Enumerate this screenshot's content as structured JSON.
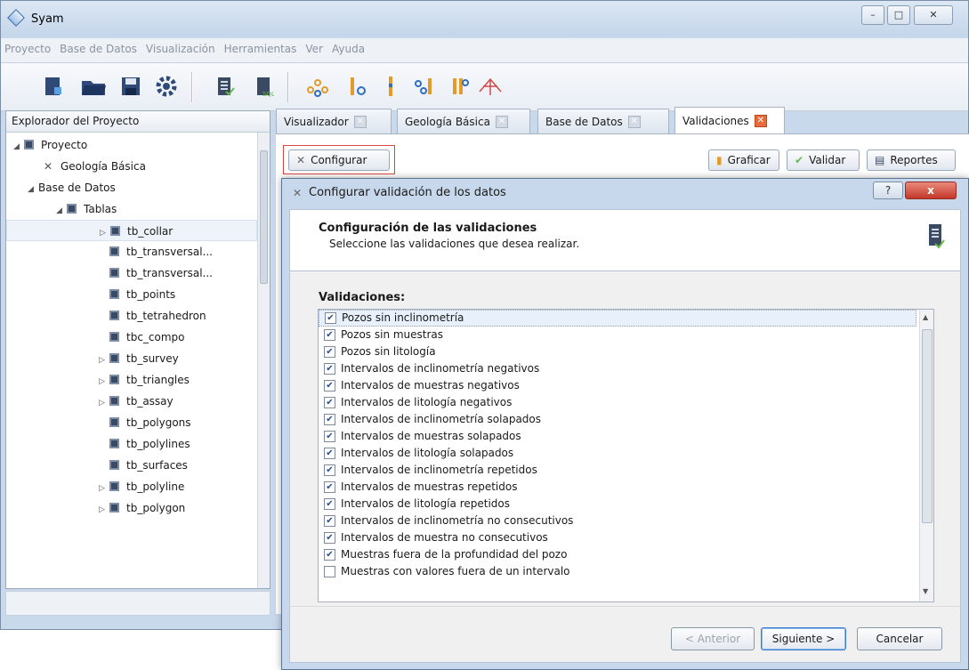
{
  "app": {
    "title": "Syam"
  },
  "window_controls": {
    "minimize": "–",
    "maximize": "□",
    "close": "✕"
  },
  "menu": [
    "Proyecto",
    "Base de Datos",
    "Visualización",
    "Herramientas",
    "Ver",
    "Ayuda"
  ],
  "explorer": {
    "title": "Explorador del Proyecto",
    "items": [
      {
        "label": "Proyecto"
      },
      {
        "label": "Geología Básica"
      },
      {
        "label": "Base de Datos"
      },
      {
        "label": "Tablas"
      },
      {
        "label": "tb_collar"
      },
      {
        "label": "tb_transversal..."
      },
      {
        "label": "tb_transversal..."
      },
      {
        "label": "tb_points"
      },
      {
        "label": "tb_tetrahedron"
      },
      {
        "label": "tbc_compo"
      },
      {
        "label": "tb_survey"
      },
      {
        "label": "tb_triangles"
      },
      {
        "label": "tb_assay"
      },
      {
        "label": "tb_polygons"
      },
      {
        "label": "tb_polylines"
      },
      {
        "label": "tb_surfaces"
      },
      {
        "label": "tb_polyline"
      },
      {
        "label": "tb_polygon"
      }
    ]
  },
  "tabs": [
    {
      "label": "Visualizador"
    },
    {
      "label": "Geología Básica"
    },
    {
      "label": "Base de Datos"
    },
    {
      "label": "Validaciones"
    }
  ],
  "tab_toolbar": {
    "configurar": "Configurar",
    "graficar": "Graficar",
    "validar": "Validar",
    "reportes": "Reportes"
  },
  "dialog": {
    "title": "Configurar validación de los datos",
    "help": "?",
    "close": "x",
    "header_title": "Configuración de las validaciones",
    "header_subtitle": "Seleccione las validaciones que desea realizar.",
    "section_label": "Validaciones:",
    "validations": [
      {
        "label": "Pozos sin inclinometría",
        "checked": true
      },
      {
        "label": "Pozos sin muestras",
        "checked": true
      },
      {
        "label": "Pozos sin litología",
        "checked": true
      },
      {
        "label": "Intervalos de inclinometría negativos",
        "checked": true
      },
      {
        "label": "Intervalos de muestras negativos",
        "checked": true
      },
      {
        "label": "Intervalos de litología negativos",
        "checked": true
      },
      {
        "label": "Intervalos de inclinometría solapados",
        "checked": true
      },
      {
        "label": "Intervalos de muestras solapados",
        "checked": true
      },
      {
        "label": "Intervalos de litología solapados",
        "checked": true
      },
      {
        "label": "Intervalos de inclinometría repetidos",
        "checked": true
      },
      {
        "label": "Intervalos de muestras repetidos",
        "checked": true
      },
      {
        "label": "Intervalos de litología repetidos",
        "checked": true
      },
      {
        "label": "Intervalos de inclinometría no consecutivos",
        "checked": true
      },
      {
        "label": "Intervalos de muestra no consecutivos",
        "checked": true
      },
      {
        "label": "Muestras fuera de la profundidad del pozo",
        "checked": true
      },
      {
        "label": "Muestras con valores fuera de un intervalo",
        "checked": false
      }
    ],
    "buttons": {
      "back": "< Anterior",
      "next": "Siguiente >",
      "cancel": "Cancelar"
    }
  },
  "colors": {
    "accent_red": "#e96b3c",
    "focus_frame": "#d8453c",
    "title_blue": "#c7d8ec"
  }
}
